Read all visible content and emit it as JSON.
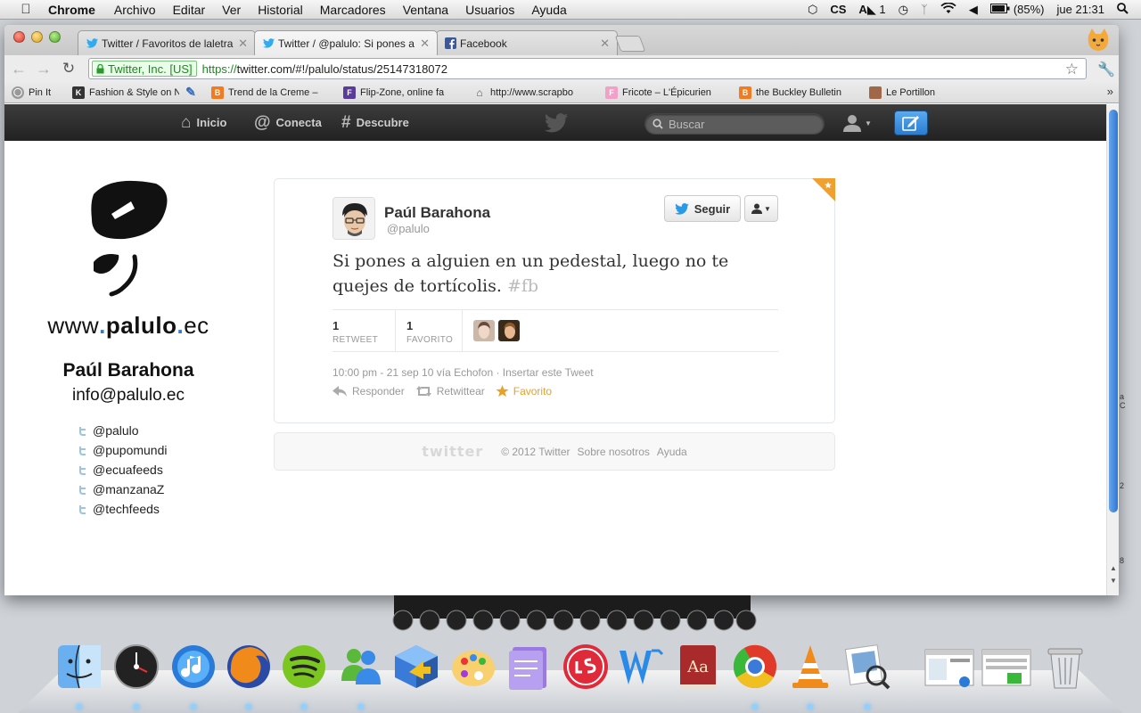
{
  "menubar": {
    "app": "Chrome",
    "items": [
      "Archivo",
      "Editar",
      "Ver",
      "Historial",
      "Marcadores",
      "Ventana",
      "Usuarios",
      "Ayuda"
    ],
    "status": {
      "input_badge": "1",
      "battery": "(85%)",
      "clock": "jue 21:31"
    }
  },
  "browser": {
    "tabs": [
      {
        "title": "Twitter / Favoritos de laletra",
        "favicon": "twitter-icon"
      },
      {
        "title": "Twitter / @palulo: Si pones a",
        "favicon": "twitter-icon"
      },
      {
        "title": "Facebook",
        "favicon": "facebook-icon"
      }
    ],
    "ev_label": "Twitter, Inc. [US]",
    "url_scheme": "https://",
    "url_rest": "twitter.com/#!/palulo/status/25147318072",
    "bookmarks": [
      "Pin It",
      "Fashion & Style on N",
      "",
      "Trend de la Creme –",
      "Flip-Zone, online fa",
      "http://www.scrapbo",
      "Fricote – L'Épicurien",
      "the Buckley Bulletin",
      "Le Portillon"
    ]
  },
  "twitter_nav": {
    "home": "Inicio",
    "connect": "Conecta",
    "discover": "Descubre",
    "search_placeholder": "Buscar"
  },
  "background_brand": {
    "www_prefix": "www",
    "www_name": "palulo",
    "www_tld": "ec",
    "name": "Paúl Barahona",
    "email": "info@palulo.ec",
    "handles": [
      "@palulo",
      "@pupomundi",
      "@ecuafeeds",
      "@manzanaZ",
      "@techfeeds"
    ]
  },
  "tweet": {
    "fullname": "Paúl Barahona",
    "username": "@palulo",
    "follow_label": "Seguir",
    "text": "Si pones a alguien en un pedestal, luego no te quejes de tortícolis. ",
    "hashtag": "#fb",
    "retweets": "1",
    "retweets_label": "RETWEET",
    "favorites": "1",
    "favorites_label": "FAVORITO",
    "meta": "10:00 pm - 21 sep 10 vía Echofon · Insertar este Tweet",
    "reply_label": "Responder",
    "retweet_label": "Retwittear",
    "favorite_label": "Favorito"
  },
  "footer": {
    "logo": "twitter",
    "copyright": "© 2012 Twitter",
    "about": "Sobre nosotros",
    "help": "Ayuda"
  },
  "desktop": {
    "edge_text": [
      "a",
      "C",
      "2",
      "8"
    ]
  },
  "dock": {
    "apps": [
      "finder-icon",
      "dashboard-icon",
      "itunes-icon",
      "firefox-icon",
      "spotify-icon",
      "messenger-icon",
      "migration-icon",
      "paint-icon",
      "notes-icon",
      "lastfm-icon",
      "word-icon",
      "dictionary-icon",
      "chrome-icon",
      "vlc-icon",
      "preview-icon",
      "window-thumb-icon",
      "window-thumb-icon",
      "trash-icon"
    ]
  },
  "colors": {
    "twitter_blue": "#2a7dd0",
    "topbar": "#2a2a2a",
    "favorite_orange": "#e8a02a"
  }
}
